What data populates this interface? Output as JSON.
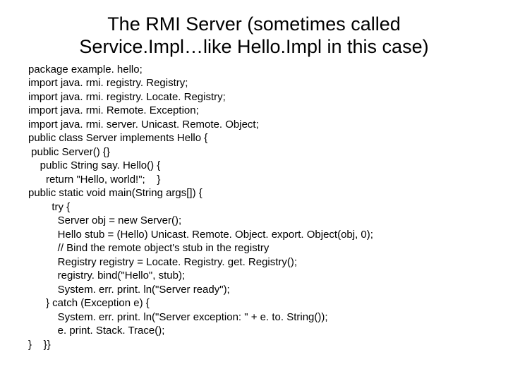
{
  "title_line1": "The RMI Server  (sometimes called",
  "title_line2": "Service.Impl…like Hello.Impl in this case)",
  "code_lines": [
    "package example. hello;",
    "import java. rmi. registry. Registry;",
    "import java. rmi. registry. Locate. Registry;",
    "import java. rmi. Remote. Exception;",
    "import java. rmi. server. Unicast. Remote. Object;",
    "public class Server implements Hello {",
    " public Server() {}",
    "    public String say. Hello() {",
    "      return \"Hello, world!\";    }",
    "public static void main(String args[]) {",
    "        try {",
    "          Server obj = new Server();",
    "          Hello stub = (Hello) Unicast. Remote. Object. export. Object(obj, 0);",
    "          // Bind the remote object's stub in the registry",
    "          Registry registry = Locate. Registry. get. Registry();",
    "          registry. bind(\"Hello\", stub);",
    "          System. err. print. ln(\"Server ready\");",
    "      } catch (Exception e) {",
    "          System. err. print. ln(\"Server exception: \" + e. to. String());",
    "          e. print. Stack. Trace();",
    "}    }}"
  ]
}
